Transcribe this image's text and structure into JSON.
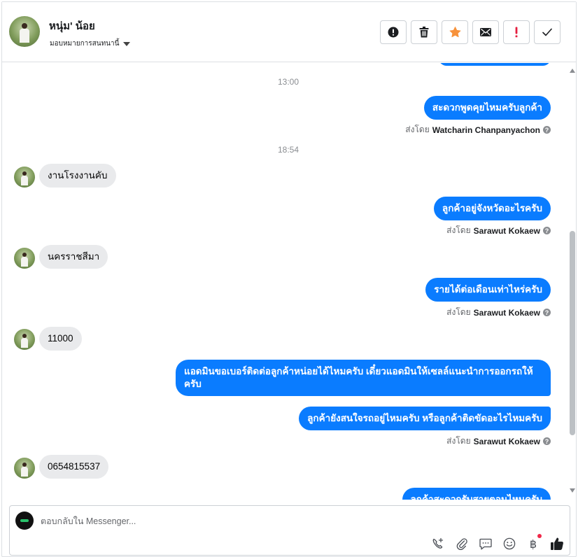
{
  "header": {
    "contact_name": "หนุ่ม' น้อย",
    "assign_label": "มอบหมายการสนทนานี้",
    "actions": [
      {
        "name": "mark-spam-button",
        "icon": "alert-circle-icon"
      },
      {
        "name": "delete-button",
        "icon": "trash-icon"
      },
      {
        "name": "star-button",
        "icon": "star-icon",
        "color": "#f7923b"
      },
      {
        "name": "mark-unread-button",
        "icon": "envelope-icon"
      },
      {
        "name": "follow-up-button",
        "icon": "exclamation-icon",
        "color": "#e41e3f"
      },
      {
        "name": "mark-done-button",
        "icon": "check-icon"
      }
    ]
  },
  "thread": {
    "timestamps": [
      "13:00",
      "18:54"
    ],
    "sent_by_label": "ส่งโดย",
    "messages": [
      {
        "dir": "out",
        "text": "สะดวกพูดคุยไหมครับลูกค้า",
        "sender": "Watcharin Chanpanyachon"
      },
      {
        "dir": "in",
        "text": "งานโรงงานคับ"
      },
      {
        "dir": "out",
        "text": "ลูกค้าอยู่จังหวัดอะไรครับ",
        "sender": "Sarawut Kokaew"
      },
      {
        "dir": "in",
        "text": "นครราชสีมา"
      },
      {
        "dir": "out",
        "text": "รายได้ต่อเดือนเท่าไหร่ครับ",
        "sender": "Sarawut Kokaew"
      },
      {
        "dir": "in",
        "text": "11000"
      },
      {
        "dir": "out",
        "text": "แอดมินขอเบอร์ติดต่อลูกค้าหน่อยได้ไหมครับ เดี๋ยวแอดมินให้เซลล์แนะนำการออกรถให้ครับ"
      },
      {
        "dir": "out",
        "text": "ลูกค้ายังสนใจรถอยู่ไหมครับ หรือลูกค้าติดขัดอะไรไหมครับ",
        "sender": "Sarawut Kokaew"
      },
      {
        "dir": "in",
        "text": "0654815537"
      },
      {
        "dir": "out",
        "text": "ลูกค้าสะดวกรับสายตอนไหนครับ"
      }
    ]
  },
  "composer": {
    "placeholder": "ตอบกลับใน Messenger...",
    "tools": [
      "phone-add-icon",
      "paperclip-icon",
      "saved-reply-icon",
      "emoji-icon",
      "baht-payment-icon",
      "thumbs-up-icon"
    ],
    "baht_symbol": "฿"
  }
}
